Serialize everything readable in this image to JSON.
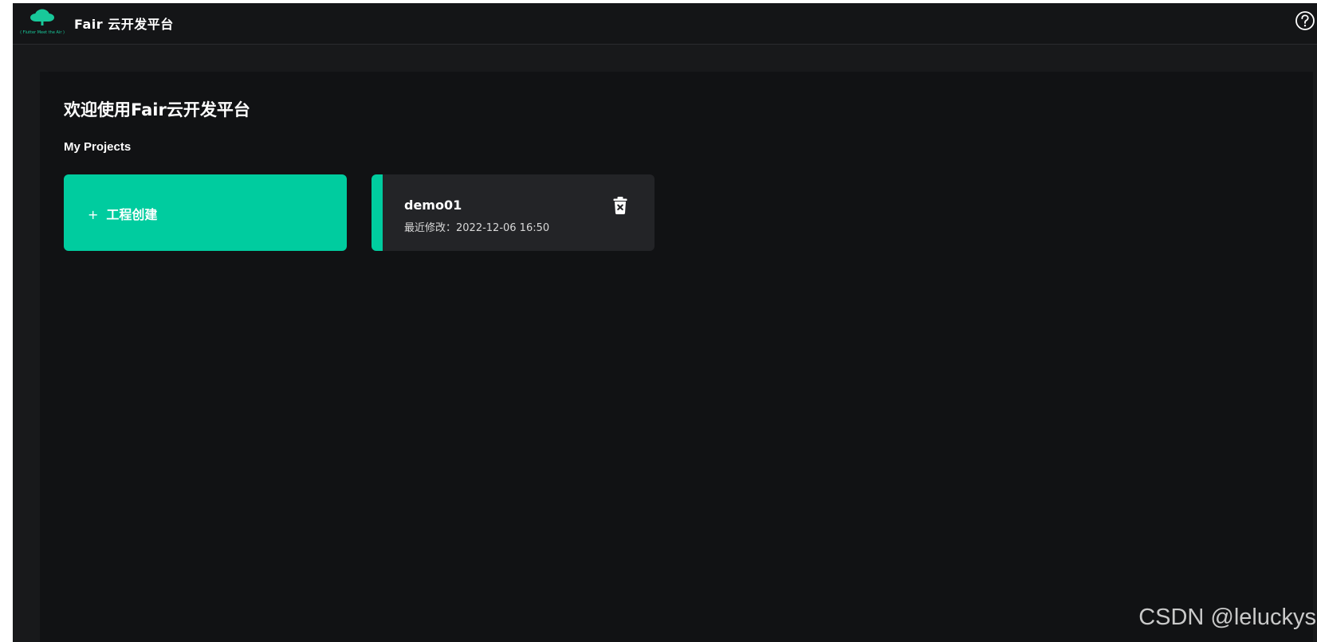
{
  "header": {
    "logo_icon": "cloud-logo-icon",
    "logo_tagline": "( Flutter Meet the Air )",
    "title": "Fair 云开发平台",
    "help_icon": "question-circle-icon"
  },
  "main": {
    "welcome": "欢迎使用Fair云开发平台",
    "section_label": "My Projects",
    "create_card": {
      "icon": "+",
      "label": "工程创建"
    },
    "projects": [
      {
        "name": "demo01",
        "modified": "最近修改：2022-12-06 16:50",
        "delete_icon": "trash-icon"
      }
    ]
  },
  "watermark": "CSDN @leluckys",
  "colors": {
    "accent": "#00cc9f",
    "background": "#111214",
    "card": "#232427",
    "header": "#141517"
  }
}
